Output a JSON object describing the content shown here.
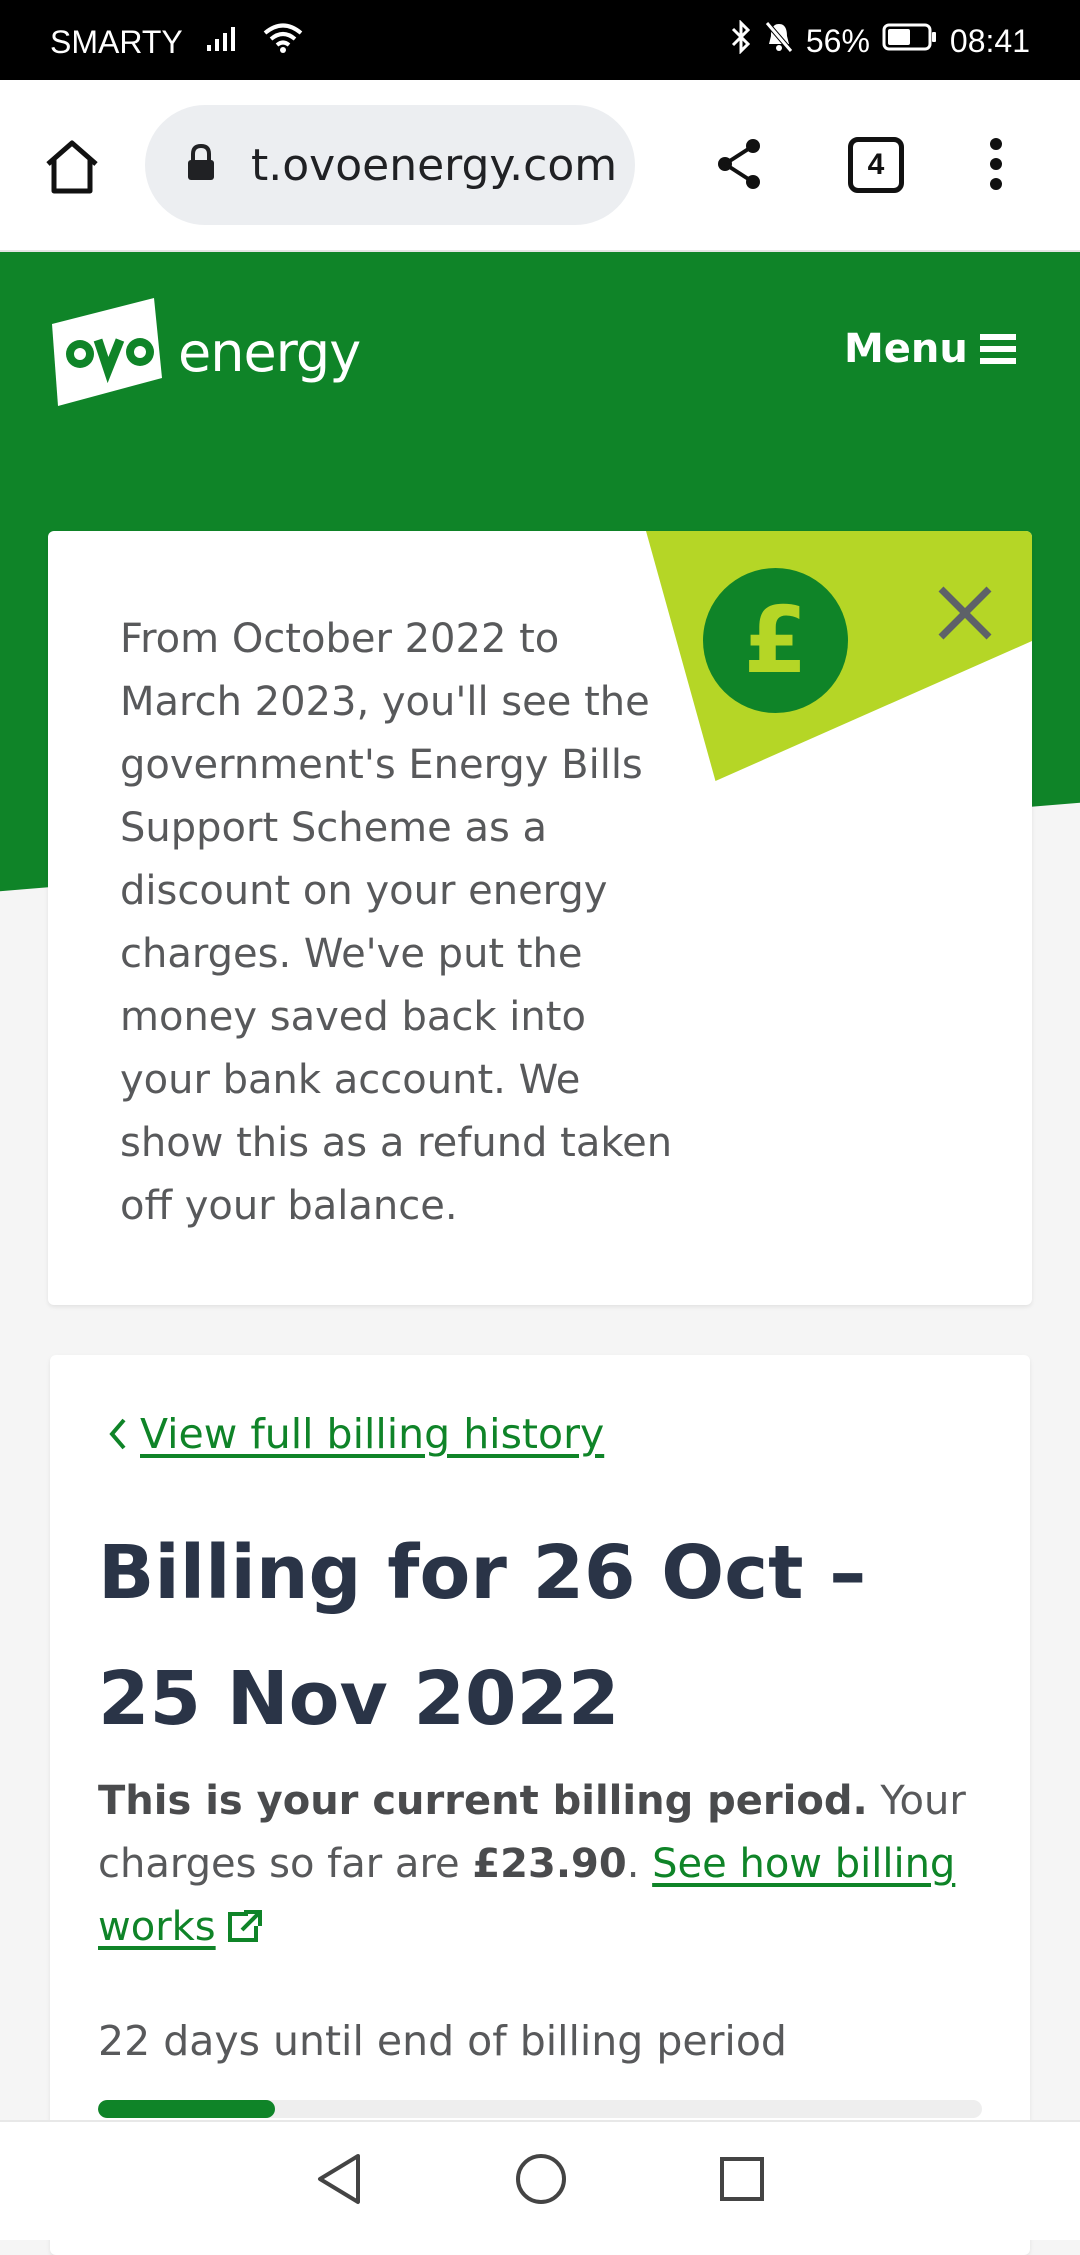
{
  "status_bar": {
    "carrier": "SMARTY",
    "battery": "56%",
    "time": "08:41"
  },
  "browser": {
    "url": "t.ovoenergy.com",
    "tab_count": "4"
  },
  "header": {
    "logo_text": "energy",
    "menu_label": "Menu"
  },
  "notice": {
    "icon_symbol": "£",
    "text": "From October 2022 to March 2023, you'll see the government's Energy Bills Support Scheme as a discount on your energy charges. We've put the money saved back into your bank account. We show this as a refund taken off your balance."
  },
  "billing": {
    "back_link": "View full billing history",
    "title": "Billing for 26 Oct – 25 Nov 2022",
    "current_period_bold": "This is your current billing period.",
    "charges_prefix": " Your charges so far are ",
    "charges_amount": "£23.90",
    "charges_suffix": ". ",
    "how_billing_link": "See how billing works",
    "days_left_text": "22 days until end of billing period",
    "progress_fraction": 0.2
  },
  "colors": {
    "brand_green": "#0f8428",
    "lime": "#b5d626",
    "heading_navy": "#2a3447"
  }
}
